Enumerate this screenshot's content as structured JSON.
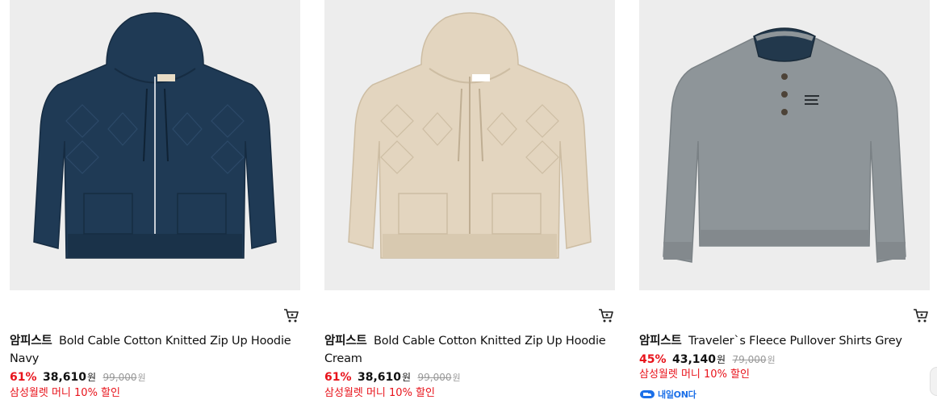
{
  "products": [
    {
      "brand": "암피스트",
      "name": "Bold Cable Cotton Knitted Zip Up Hoodie Navy",
      "discount": "61%",
      "price": "38,610",
      "currency": "원",
      "original_price": "99,000",
      "original_currency": "원",
      "promo": "삼성월렛 머니 10% 할인",
      "garment_color": "#1f3a55",
      "image_icon": "zip-up-hoodie"
    },
    {
      "brand": "암피스트",
      "name": "Bold Cable Cotton Knitted Zip Up Hoodie Cream",
      "discount": "61%",
      "price": "38,610",
      "currency": "원",
      "original_price": "99,000",
      "original_currency": "원",
      "promo": "삼성월렛 머니 10% 할인",
      "garment_color": "#e3d5bf",
      "image_icon": "zip-up-hoodie"
    },
    {
      "brand": "암피스트",
      "name": "Traveler`s Fleece Pullover Shirts Grey",
      "discount": "45%",
      "price": "43,140",
      "currency": "원",
      "original_price": "79,000",
      "original_currency": "원",
      "promo": "삼성월렛 머니 10% 할인",
      "delivery_badge": "내일ON다",
      "garment_color": "#8e9599",
      "image_icon": "henley-pullover"
    }
  ],
  "colors": {
    "thumb_bg": "#ededed",
    "discount_red": "#e8131b",
    "badge_blue": "#1b6fe8"
  },
  "icons": {
    "cart": "cart-icon",
    "delivery": "delivery-truck-icon"
  }
}
